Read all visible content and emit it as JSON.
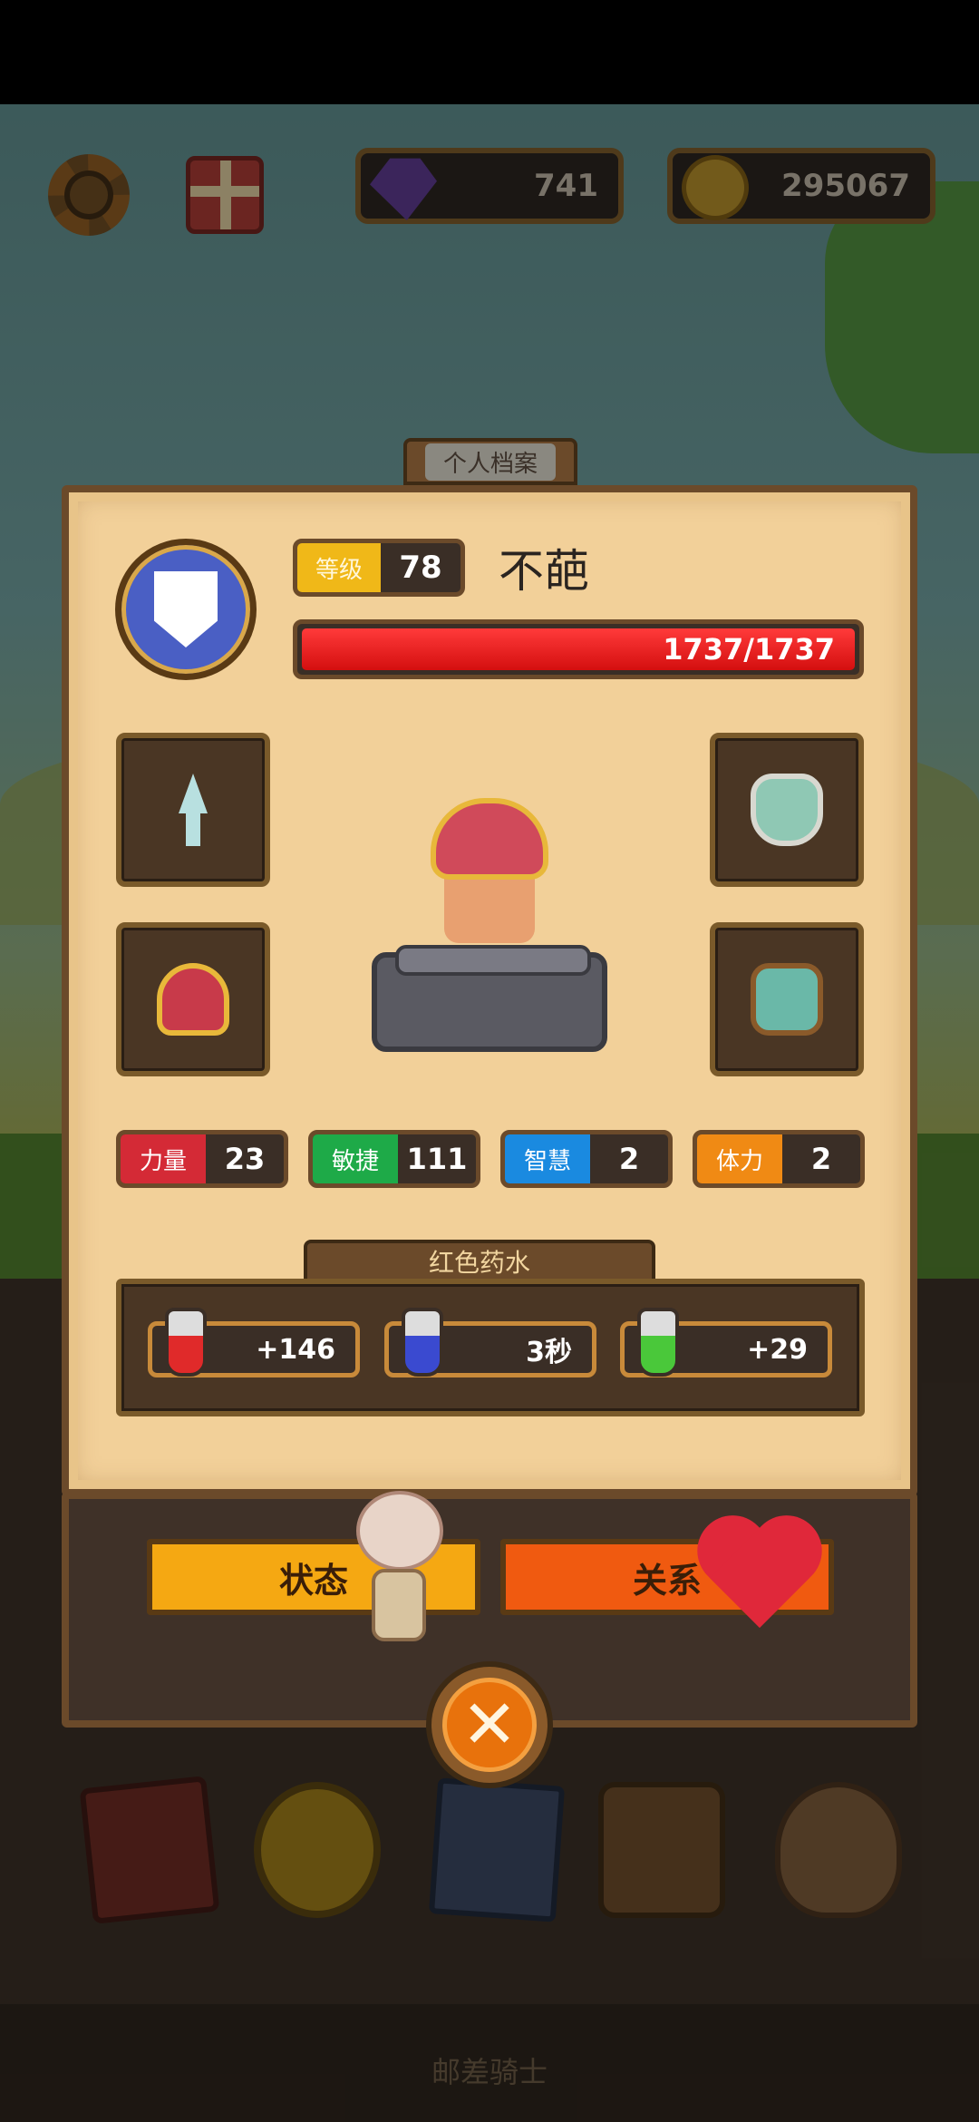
{
  "top_bar": {
    "gems": "741",
    "coins": "295067"
  },
  "profile_tab": {
    "label": "个人档案"
  },
  "player": {
    "level_label": "等级",
    "level": "78",
    "name": "不葩",
    "hp": "1737/1737"
  },
  "stats": [
    {
      "label": "力量",
      "value": "23",
      "color": "#d42a36"
    },
    {
      "label": "敏捷",
      "value": "111",
      "color": "#1eaa48"
    },
    {
      "label": "智慧",
      "value": "2",
      "color": "#1a8ae0"
    },
    {
      "label": "体力",
      "value": "2",
      "color": "#f08a14"
    }
  ],
  "potion": {
    "title": "红色药水",
    "items": [
      {
        "value": "+146",
        "icon": "red-potion-heart-icon"
      },
      {
        "value": "3秒",
        "icon": "blue-potion-hourglass-icon"
      },
      {
        "value": "+29",
        "icon": "green-potion-shield-icon"
      }
    ]
  },
  "buttons": {
    "status": "状态",
    "relation": "关系",
    "close": "✕"
  },
  "bottom_label": "邮差骑士"
}
